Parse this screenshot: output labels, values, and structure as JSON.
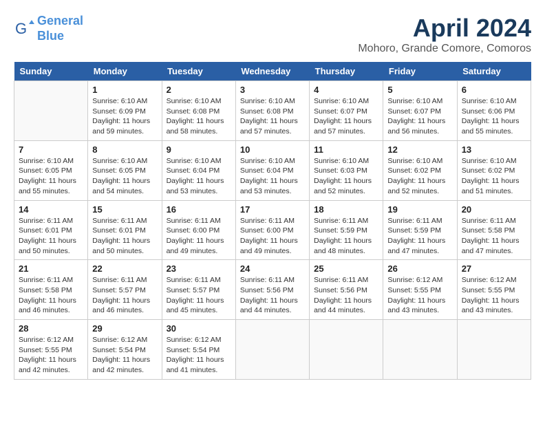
{
  "logo": {
    "line1": "General",
    "line2": "Blue"
  },
  "title": "April 2024",
  "location": "Mohoro, Grande Comore, Comoros",
  "headers": [
    "Sunday",
    "Monday",
    "Tuesday",
    "Wednesday",
    "Thursday",
    "Friday",
    "Saturday"
  ],
  "weeks": [
    [
      {
        "day": "",
        "info": ""
      },
      {
        "day": "1",
        "info": "Sunrise: 6:10 AM\nSunset: 6:09 PM\nDaylight: 11 hours\nand 59 minutes."
      },
      {
        "day": "2",
        "info": "Sunrise: 6:10 AM\nSunset: 6:08 PM\nDaylight: 11 hours\nand 58 minutes."
      },
      {
        "day": "3",
        "info": "Sunrise: 6:10 AM\nSunset: 6:08 PM\nDaylight: 11 hours\nand 57 minutes."
      },
      {
        "day": "4",
        "info": "Sunrise: 6:10 AM\nSunset: 6:07 PM\nDaylight: 11 hours\nand 57 minutes."
      },
      {
        "day": "5",
        "info": "Sunrise: 6:10 AM\nSunset: 6:07 PM\nDaylight: 11 hours\nand 56 minutes."
      },
      {
        "day": "6",
        "info": "Sunrise: 6:10 AM\nSunset: 6:06 PM\nDaylight: 11 hours\nand 55 minutes."
      }
    ],
    [
      {
        "day": "7",
        "info": "Sunrise: 6:10 AM\nSunset: 6:05 PM\nDaylight: 11 hours\nand 55 minutes."
      },
      {
        "day": "8",
        "info": "Sunrise: 6:10 AM\nSunset: 6:05 PM\nDaylight: 11 hours\nand 54 minutes."
      },
      {
        "day": "9",
        "info": "Sunrise: 6:10 AM\nSunset: 6:04 PM\nDaylight: 11 hours\nand 53 minutes."
      },
      {
        "day": "10",
        "info": "Sunrise: 6:10 AM\nSunset: 6:04 PM\nDaylight: 11 hours\nand 53 minutes."
      },
      {
        "day": "11",
        "info": "Sunrise: 6:10 AM\nSunset: 6:03 PM\nDaylight: 11 hours\nand 52 minutes."
      },
      {
        "day": "12",
        "info": "Sunrise: 6:10 AM\nSunset: 6:02 PM\nDaylight: 11 hours\nand 52 minutes."
      },
      {
        "day": "13",
        "info": "Sunrise: 6:10 AM\nSunset: 6:02 PM\nDaylight: 11 hours\nand 51 minutes."
      }
    ],
    [
      {
        "day": "14",
        "info": "Sunrise: 6:11 AM\nSunset: 6:01 PM\nDaylight: 11 hours\nand 50 minutes."
      },
      {
        "day": "15",
        "info": "Sunrise: 6:11 AM\nSunset: 6:01 PM\nDaylight: 11 hours\nand 50 minutes."
      },
      {
        "day": "16",
        "info": "Sunrise: 6:11 AM\nSunset: 6:00 PM\nDaylight: 11 hours\nand 49 minutes."
      },
      {
        "day": "17",
        "info": "Sunrise: 6:11 AM\nSunset: 6:00 PM\nDaylight: 11 hours\nand 49 minutes."
      },
      {
        "day": "18",
        "info": "Sunrise: 6:11 AM\nSunset: 5:59 PM\nDaylight: 11 hours\nand 48 minutes."
      },
      {
        "day": "19",
        "info": "Sunrise: 6:11 AM\nSunset: 5:59 PM\nDaylight: 11 hours\nand 47 minutes."
      },
      {
        "day": "20",
        "info": "Sunrise: 6:11 AM\nSunset: 5:58 PM\nDaylight: 11 hours\nand 47 minutes."
      }
    ],
    [
      {
        "day": "21",
        "info": "Sunrise: 6:11 AM\nSunset: 5:58 PM\nDaylight: 11 hours\nand 46 minutes."
      },
      {
        "day": "22",
        "info": "Sunrise: 6:11 AM\nSunset: 5:57 PM\nDaylight: 11 hours\nand 46 minutes."
      },
      {
        "day": "23",
        "info": "Sunrise: 6:11 AM\nSunset: 5:57 PM\nDaylight: 11 hours\nand 45 minutes."
      },
      {
        "day": "24",
        "info": "Sunrise: 6:11 AM\nSunset: 5:56 PM\nDaylight: 11 hours\nand 44 minutes."
      },
      {
        "day": "25",
        "info": "Sunrise: 6:11 AM\nSunset: 5:56 PM\nDaylight: 11 hours\nand 44 minutes."
      },
      {
        "day": "26",
        "info": "Sunrise: 6:12 AM\nSunset: 5:55 PM\nDaylight: 11 hours\nand 43 minutes."
      },
      {
        "day": "27",
        "info": "Sunrise: 6:12 AM\nSunset: 5:55 PM\nDaylight: 11 hours\nand 43 minutes."
      }
    ],
    [
      {
        "day": "28",
        "info": "Sunrise: 6:12 AM\nSunset: 5:55 PM\nDaylight: 11 hours\nand 42 minutes."
      },
      {
        "day": "29",
        "info": "Sunrise: 6:12 AM\nSunset: 5:54 PM\nDaylight: 11 hours\nand 42 minutes."
      },
      {
        "day": "30",
        "info": "Sunrise: 6:12 AM\nSunset: 5:54 PM\nDaylight: 11 hours\nand 41 minutes."
      },
      {
        "day": "",
        "info": ""
      },
      {
        "day": "",
        "info": ""
      },
      {
        "day": "",
        "info": ""
      },
      {
        "day": "",
        "info": ""
      }
    ]
  ]
}
